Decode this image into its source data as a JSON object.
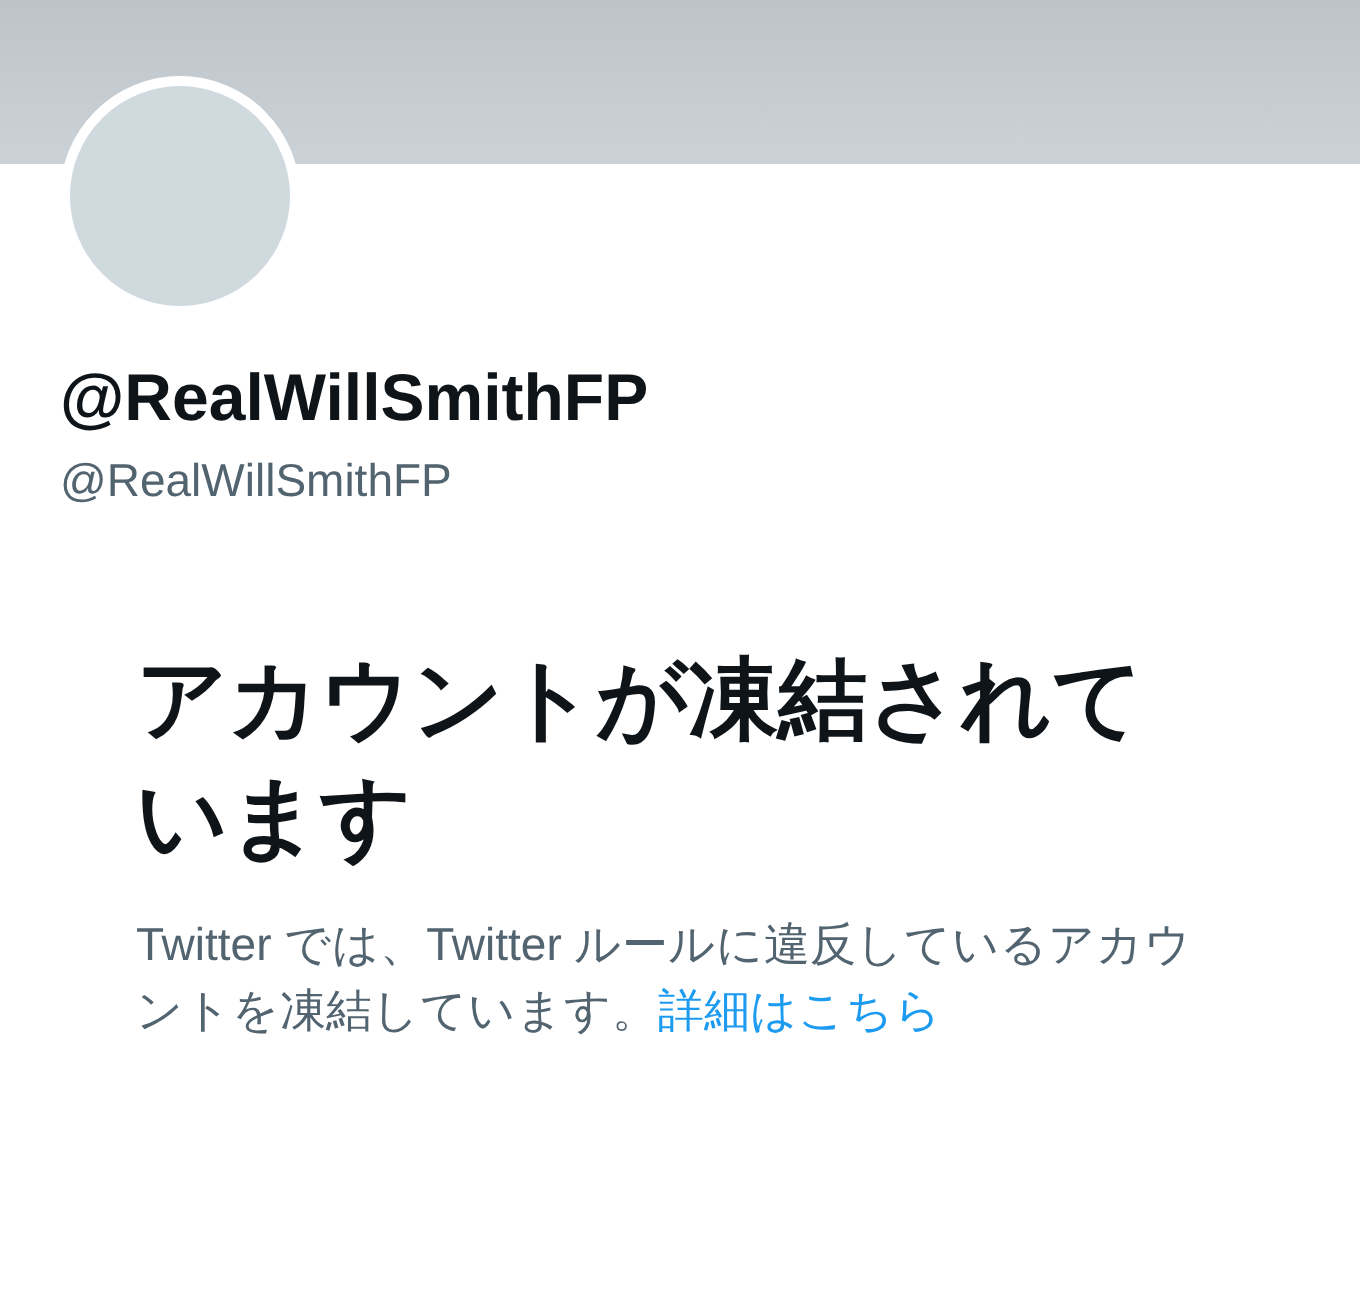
{
  "profile": {
    "display_name": "@RealWillSmithFP",
    "handle": "@RealWillSmithFP"
  },
  "notice": {
    "title": "アカウントが凍結されています",
    "body": "Twitter では、Twitter ルールに違反しているアカウントを凍結しています。",
    "link": "詳細はこちら"
  }
}
